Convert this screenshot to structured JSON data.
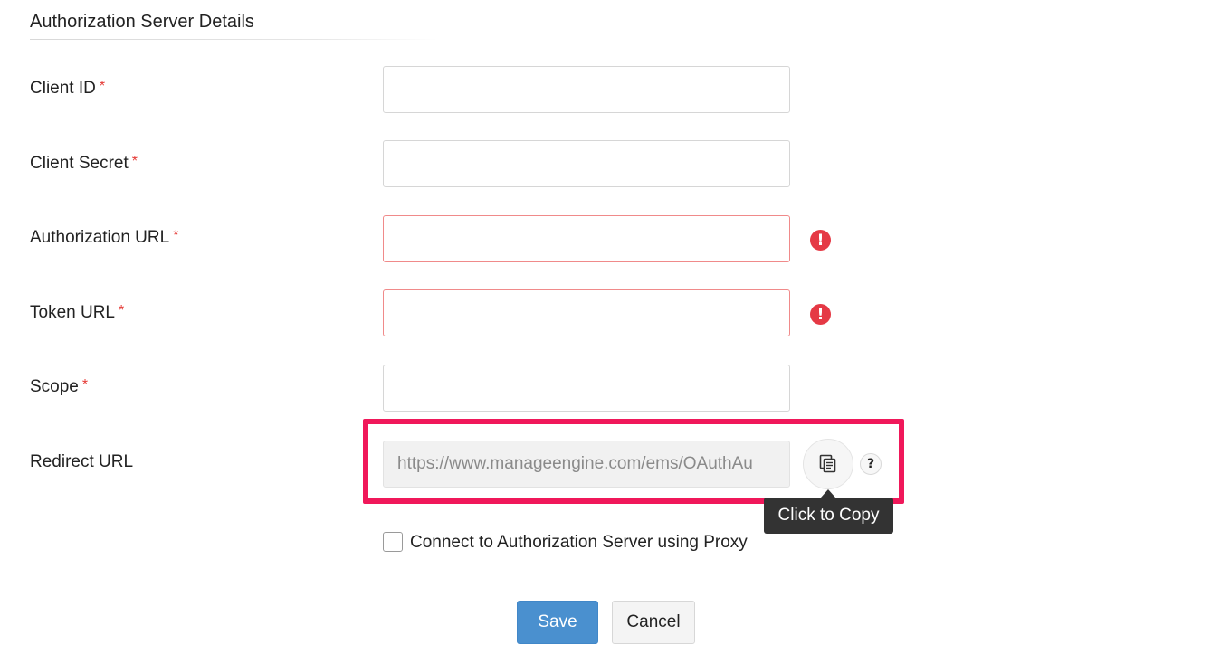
{
  "section": {
    "title": "Authorization Server Details"
  },
  "fields": [
    {
      "label": "Client ID",
      "required_mark": "*",
      "value": ""
    },
    {
      "label": "Client Secret",
      "required_mark": "*",
      "value": ""
    },
    {
      "label": "Authorization URL",
      "required_mark": "*",
      "value": "",
      "error_icon": "!"
    },
    {
      "label": "Token URL",
      "required_mark": "*",
      "value": "",
      "error_icon": "!"
    },
    {
      "label": "Scope",
      "required_mark": "*",
      "value": ""
    }
  ],
  "redirect": {
    "label": "Redirect URL",
    "value": "https://www.manageengine.com/ems/OAuthAu",
    "copy_icon": "copy-icon",
    "help_icon": "?",
    "tooltip": "Click to Copy"
  },
  "proxy": {
    "label": "Connect to Authorization Server using Proxy",
    "checked": false
  },
  "actions": {
    "save": "Save",
    "cancel": "Cancel"
  },
  "colors": {
    "accent": "#4a90cf",
    "error": "#e53945",
    "highlight": "#f0185a"
  }
}
